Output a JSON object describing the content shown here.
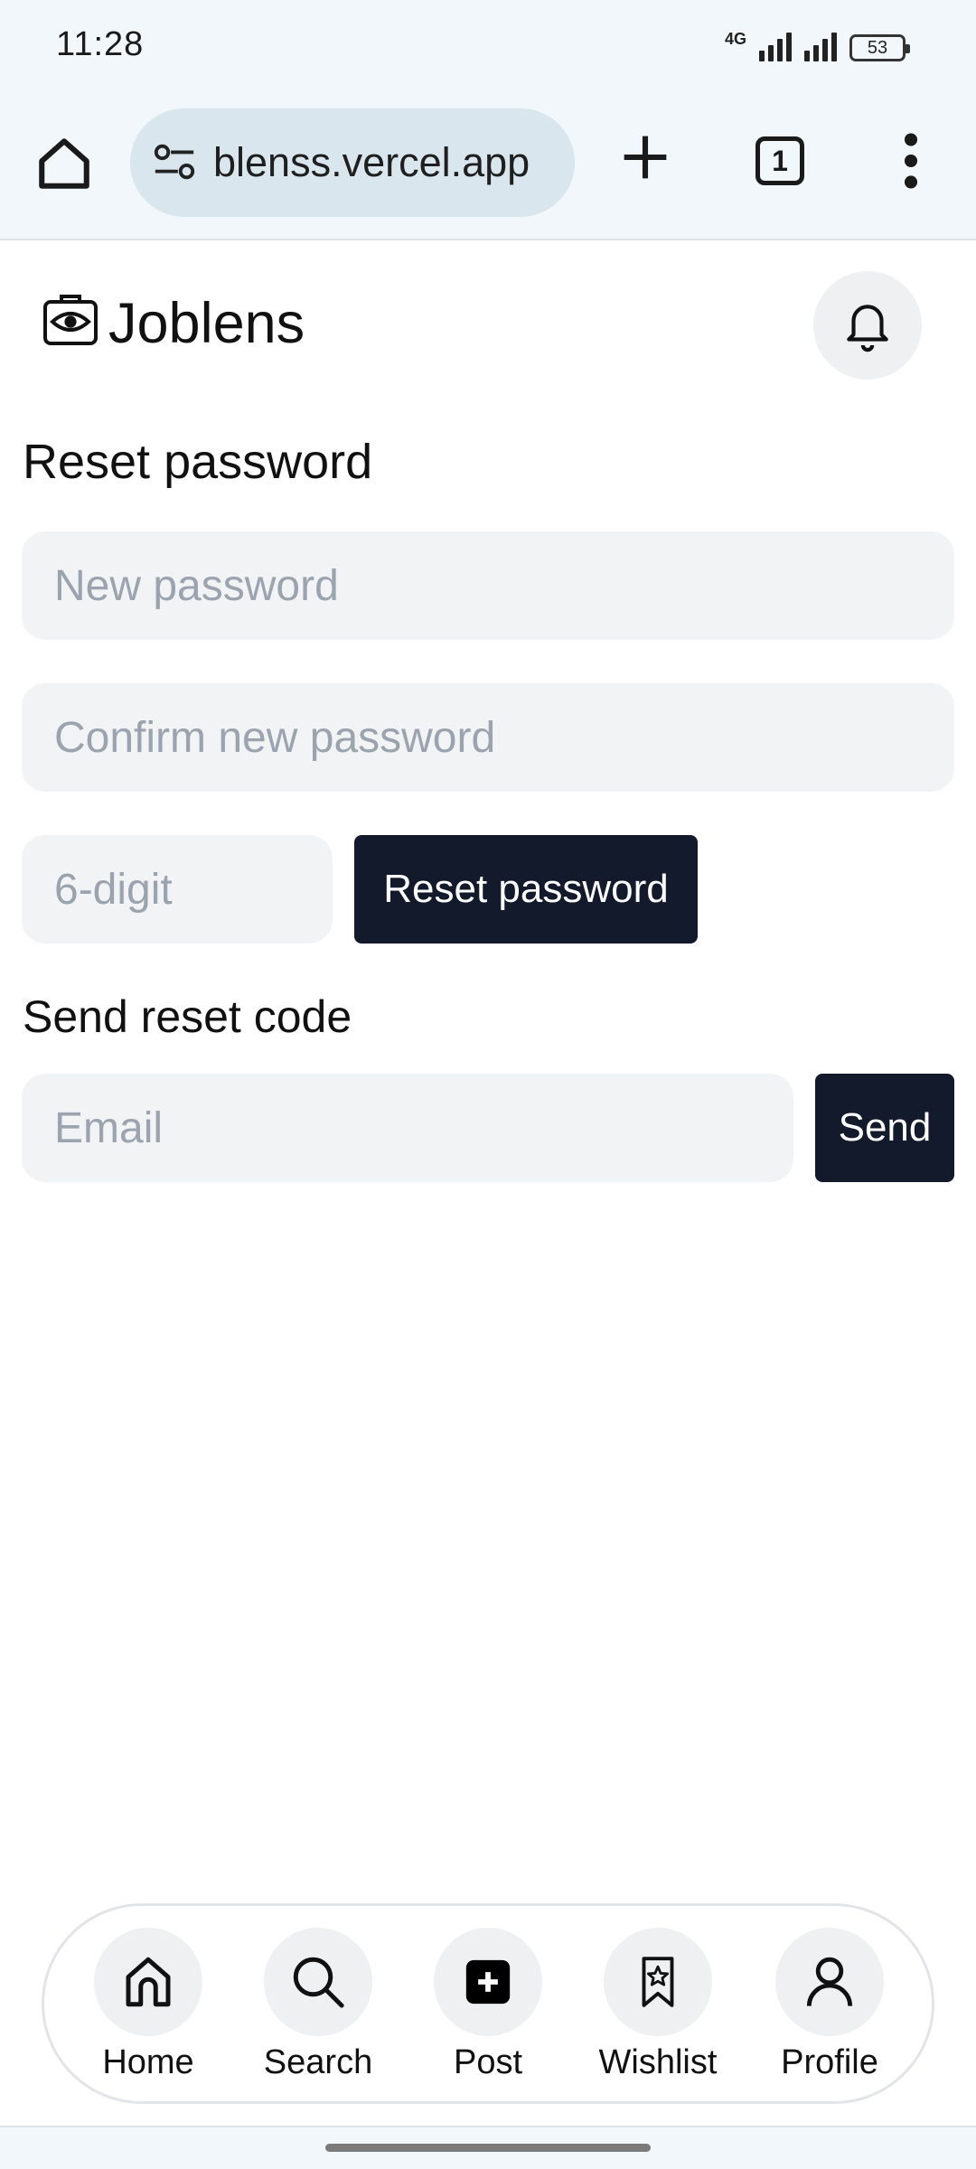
{
  "status_bar": {
    "time": "11:28",
    "network": "4G",
    "battery": "53"
  },
  "browser": {
    "url": "blenss.vercel.app",
    "tab_count": "1",
    "icons": [
      "home-icon",
      "site-settings-icon",
      "new-tab-plus-icon",
      "tab-switcher-icon",
      "more-vert-icon"
    ]
  },
  "header": {
    "brand": "Joblens",
    "logo_icon": "briefcase-eye-icon",
    "notification_icon": "bell-icon"
  },
  "reset_form": {
    "heading": "Reset password",
    "new_password_placeholder": "New password",
    "confirm_password_placeholder": "Confirm new password",
    "code_placeholder": "6-digit",
    "submit_label": "Reset password"
  },
  "send_code_form": {
    "heading": "Send reset code",
    "email_placeholder": "Email",
    "submit_label": "Send"
  },
  "bottom_nav": {
    "items": [
      {
        "label": "Home",
        "icon": "home-icon"
      },
      {
        "label": "Search",
        "icon": "search-icon"
      },
      {
        "label": "Post",
        "icon": "plus-square-icon"
      },
      {
        "label": "Wishlist",
        "icon": "bookmark-star-icon"
      },
      {
        "label": "Profile",
        "icon": "user-icon"
      }
    ]
  },
  "colors": {
    "primary_button": "#121a2b",
    "input_background": "#f2f3f5",
    "placeholder": "#9ba3af",
    "browser_chrome": "#f2f7fb",
    "url_pill": "#d9e6ee"
  }
}
